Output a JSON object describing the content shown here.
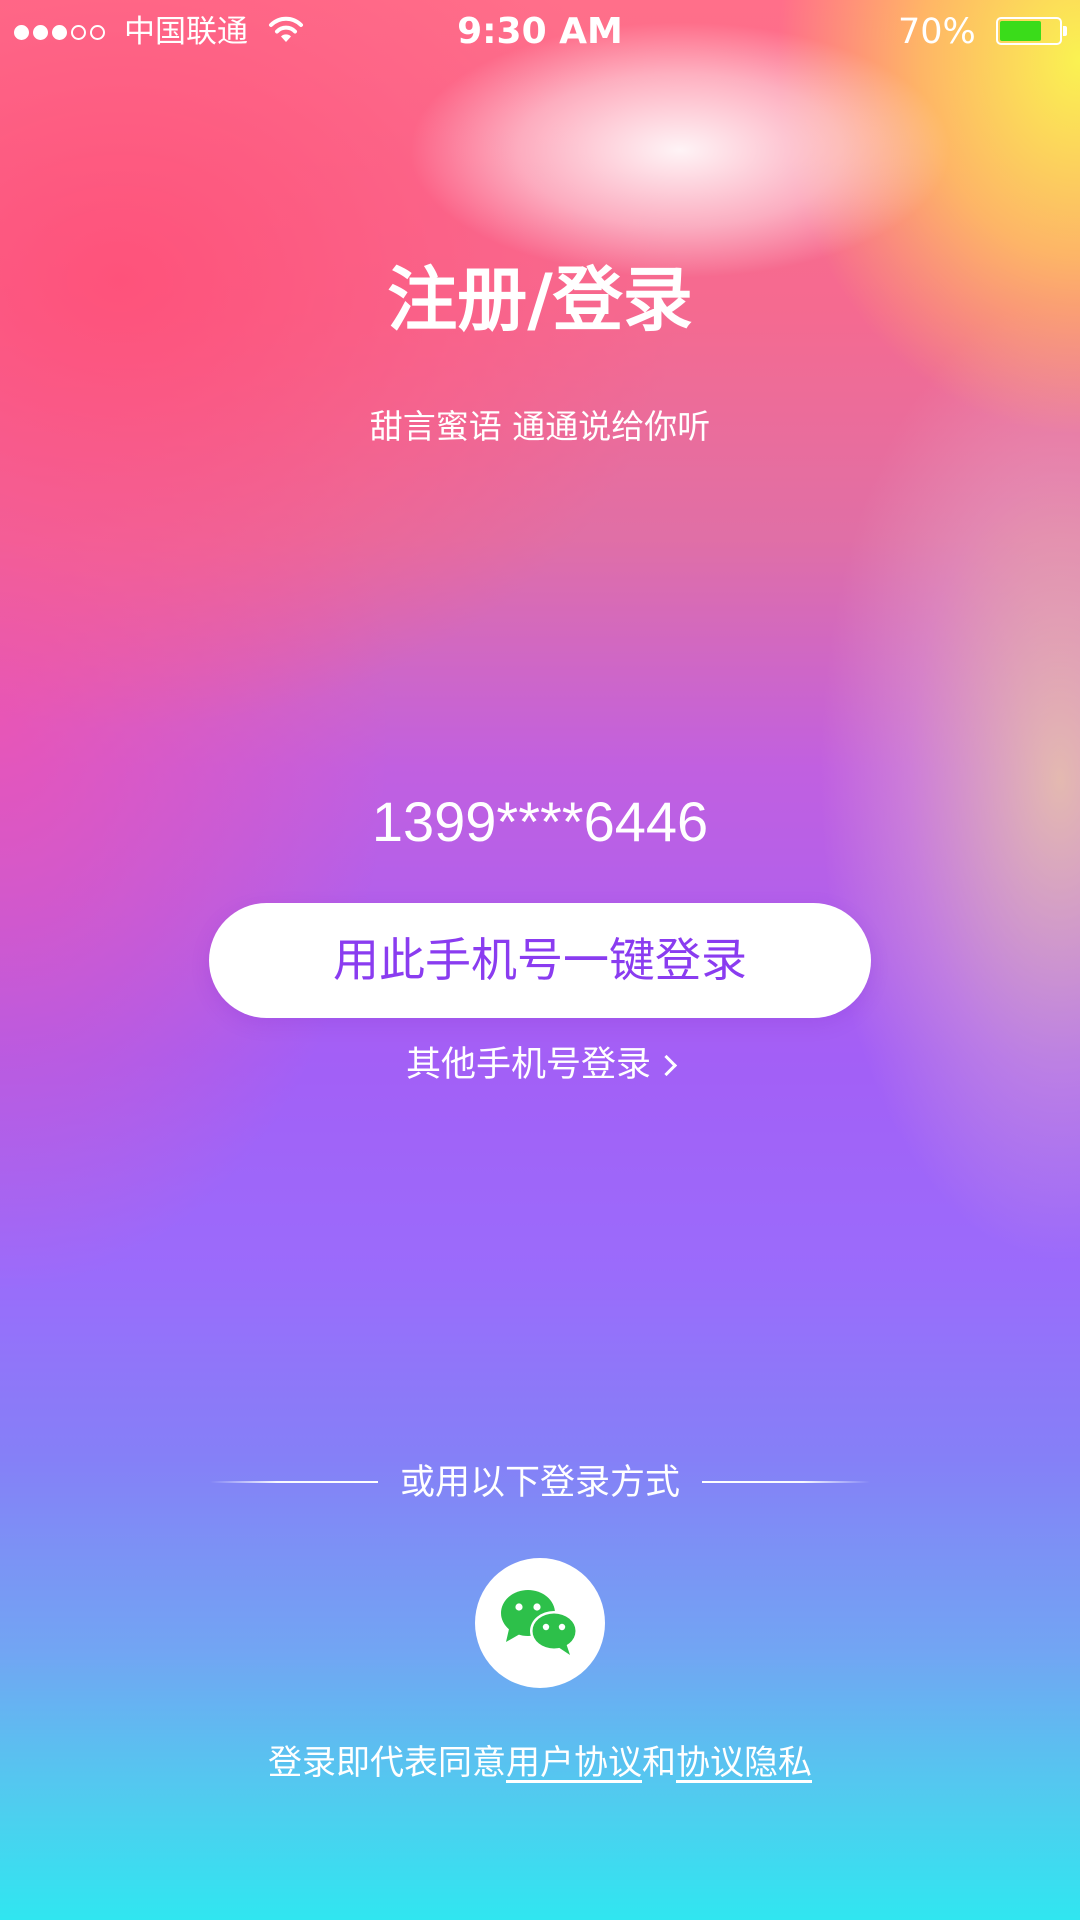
{
  "status_bar": {
    "signal_bars_filled": 3,
    "signal_bars_total": 5,
    "carrier": "中国联通",
    "time": "9:30 AM",
    "battery_percent": "70%",
    "battery_level": 0.7,
    "battery_color": "#3adc1a"
  },
  "header": {
    "title": "注册/登录",
    "subtitle": "甜言蜜语 通通说给你听"
  },
  "login": {
    "phone_number": "1399****6446",
    "one_tap_button_label": "用此手机号一键登录",
    "other_phone_link_label": "其他手机号登录"
  },
  "alternatives": {
    "divider_text": "或用以下登录方式",
    "methods": [
      {
        "icon": "wechat-icon",
        "color": "#2dc04a"
      }
    ]
  },
  "agreement": {
    "prefix": "登录即代表同意",
    "user_agreement_link": "用户协议",
    "conjunction": "和",
    "privacy_link": "协议隐私"
  },
  "colors": {
    "button_text": "#8a3cf0",
    "button_background": "#ffffff"
  }
}
